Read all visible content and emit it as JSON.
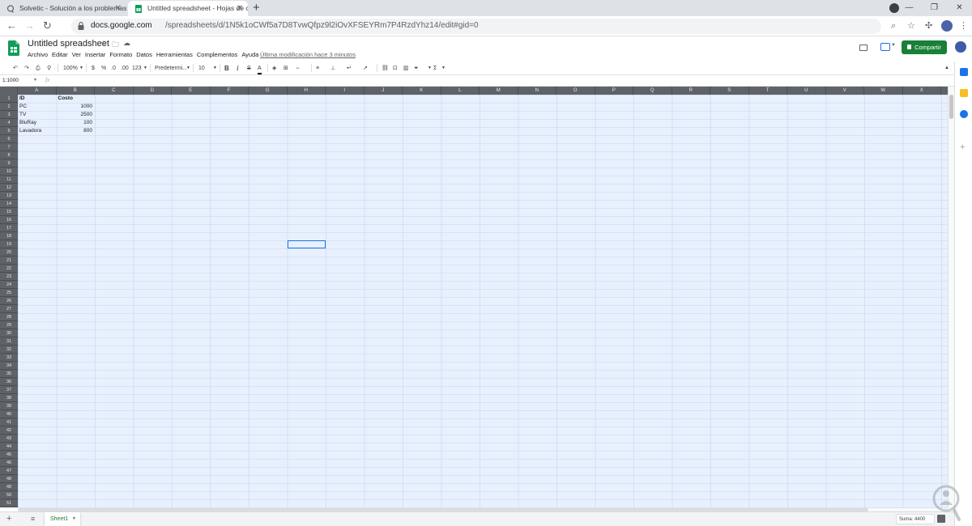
{
  "browser": {
    "tabs": [
      {
        "title": "Solvetic - Solución a los problemas",
        "active": false
      },
      {
        "title": "Untitled spreadsheet - Hojas de cálc",
        "active": true
      }
    ],
    "url_host": "docs.google.com",
    "url_path": "/spreadsheets/d/1N5k1oCWf5a7D8TvwQfpz9l2iOvXFSEYRm7P4RzdYhz14/edit#gid=0",
    "window_controls": [
      "—",
      "❐",
      "✕"
    ]
  },
  "doc": {
    "title": "Untitled spreadsheet",
    "menu": [
      "Archivo",
      "Editar",
      "Ver",
      "Insertar",
      "Formato",
      "Datos",
      "Herramientas",
      "Complementos",
      "Ayuda"
    ],
    "last_edit": "Última modificación hace 3 minutos",
    "share_label": "Compartir"
  },
  "toolbar": {
    "zoom": "100%",
    "currency": "$",
    "percent": "%",
    "dec_less": ".0",
    "dec_more": ".00",
    "more_formats": "123",
    "font": "Predetermi...",
    "font_size": "10",
    "bold": "B",
    "italic": "I",
    "strike": "S",
    "text_color": "A",
    "sum": "Σ"
  },
  "formula_bar": {
    "name_box": "1:1000",
    "fx": "fx",
    "value": ""
  },
  "grid": {
    "columns": [
      "A",
      "B",
      "C",
      "D",
      "E",
      "F",
      "G",
      "H",
      "I",
      "J",
      "K",
      "L",
      "M",
      "N",
      "O",
      "P",
      "Q",
      "R",
      "S",
      "T",
      "U",
      "V",
      "W",
      "X"
    ],
    "cells": {
      "A1": "ID",
      "B1": "Costo",
      "A2": "PC",
      "B2": "1000",
      "A3": "TV",
      "B3": "2500",
      "A4": "BluRay",
      "B4": "100",
      "A5": "Lavadora",
      "B5": "800"
    },
    "row_count": 51,
    "active_cell": "H19"
  },
  "sheetbar": {
    "add": "+",
    "all_sheets": "≡",
    "sheet_name": "Sheet1",
    "sum_label": "Suma: 4400"
  },
  "colors": {
    "accent": "#1a73e8",
    "share_green": "#188038",
    "selection": "#e8f0fe",
    "header_dark": "#5f6368"
  }
}
